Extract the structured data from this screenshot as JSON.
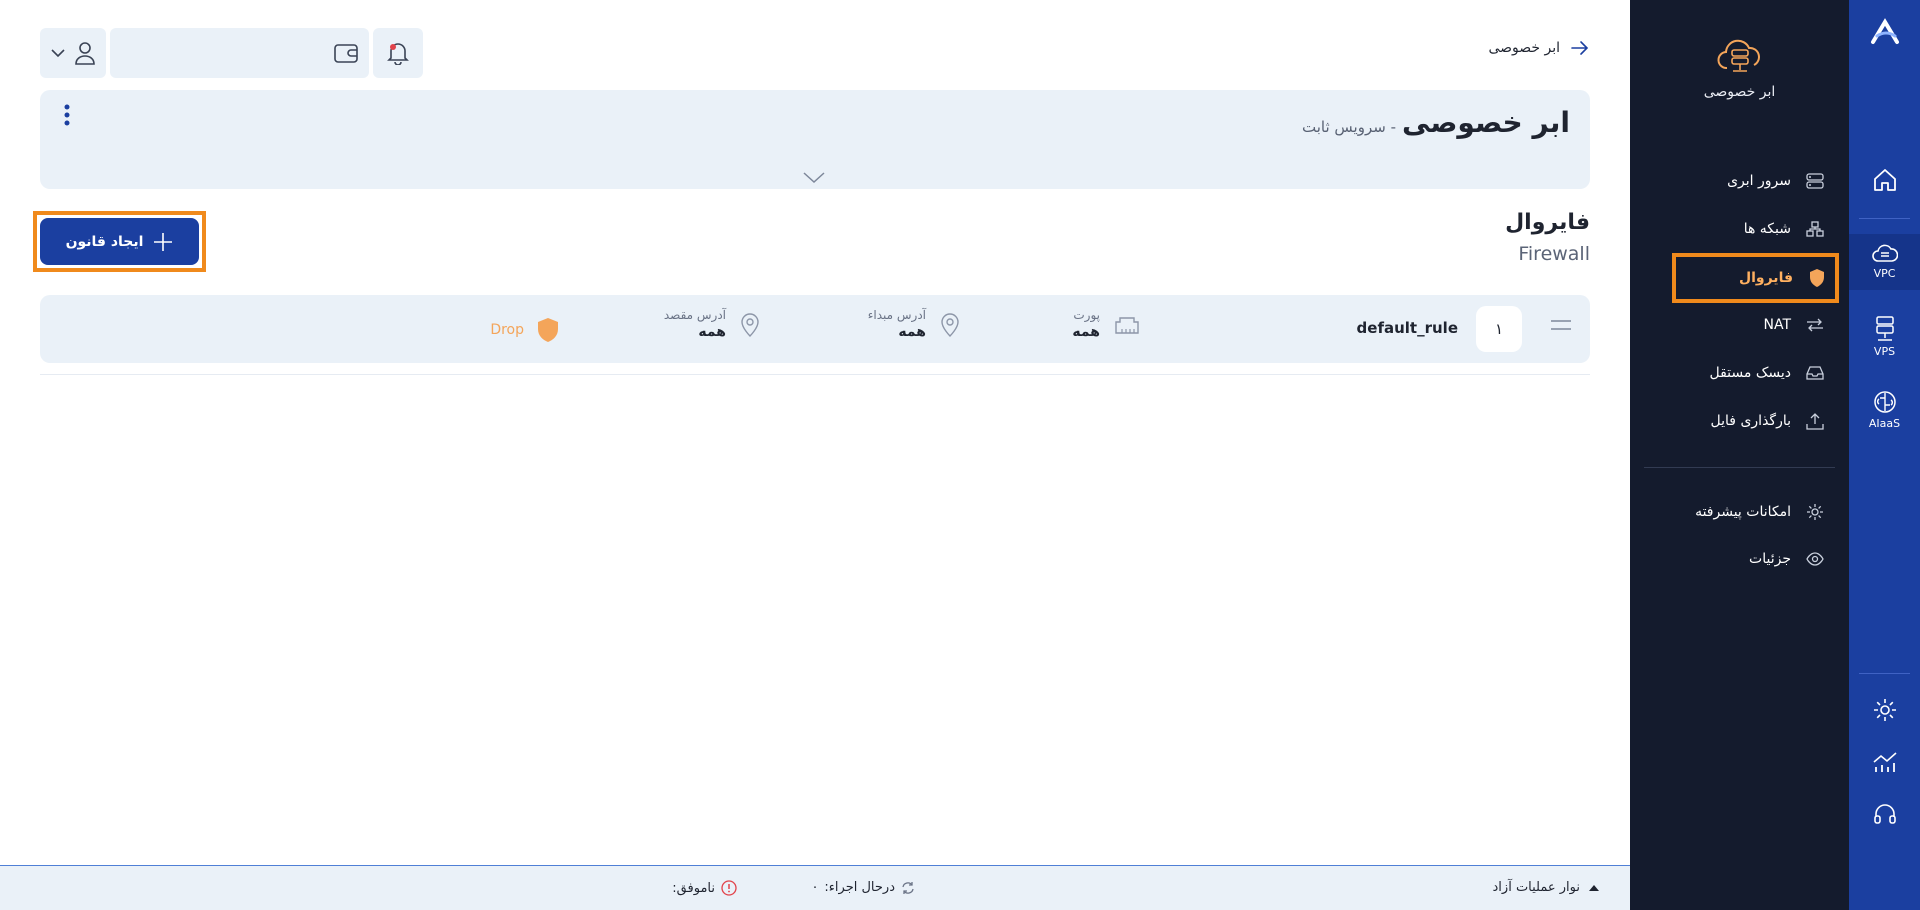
{
  "rail": {
    "vpc_label": "VPC",
    "vps_label": "VPS",
    "aiaas_label": "AIaaS"
  },
  "sidebar": {
    "brand_name": "ابر خصوصی",
    "items": [
      {
        "label": "سرور ابری",
        "icon": "server-icon"
      },
      {
        "label": "شبکه ها",
        "icon": "network-icon"
      },
      {
        "label": "فایروال",
        "icon": "shield-icon",
        "active": true
      },
      {
        "label": "NAT",
        "icon": "arrows-icon"
      },
      {
        "label": "دیسک مستقل",
        "icon": "disk-icon"
      },
      {
        "label": "بارگذاری فایل",
        "icon": "upload-icon"
      }
    ],
    "extra_items": [
      {
        "label": "امکانات پیشرفته",
        "icon": "gear-icon"
      },
      {
        "label": "جزئیات",
        "icon": "eye-icon"
      }
    ]
  },
  "header": {
    "back_label": "ابر خصوصی"
  },
  "service": {
    "title": "ابر خصوصی",
    "subtitle": "- سرویس ثابت"
  },
  "section": {
    "title_fa": "فایروال",
    "title_en": "Firewall",
    "create_button": "ایجاد قانون"
  },
  "rules": [
    {
      "number": "۱",
      "name": "default_rule",
      "port_label": "پورت",
      "port_value": "همه",
      "source_label": "آدرس مبداء",
      "source_value": "همه",
      "dest_label": "آدرس مقصد",
      "dest_value": "همه",
      "action": "Drop"
    }
  ],
  "statusbar": {
    "toggle_label": "نوار عملیات آزاد",
    "running_label": "درحال اجراء:",
    "running_count": "۰",
    "failed_label": "ناموفق:"
  },
  "colors": {
    "rail": "#1b3fa0",
    "sidebar": "#141b2d",
    "accent_orange": "#f08a1c",
    "card_bg": "#eaf1f8"
  }
}
